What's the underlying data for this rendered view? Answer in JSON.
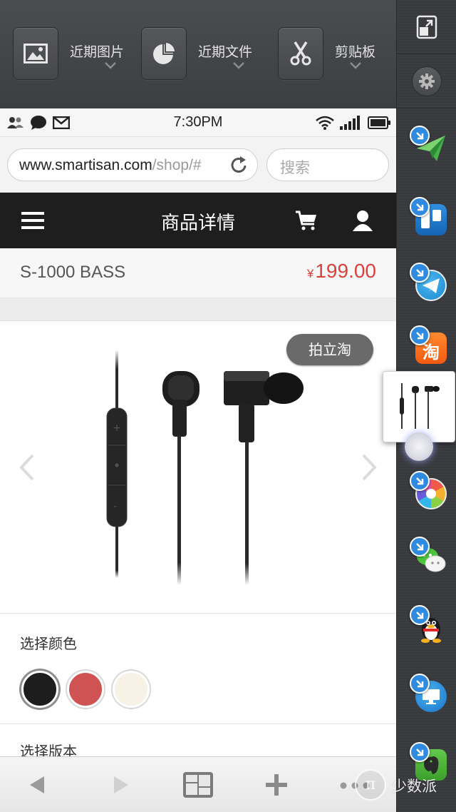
{
  "shelf": {
    "items": [
      {
        "label": "近期图片",
        "icon": "image-icon"
      },
      {
        "label": "近期文件",
        "icon": "pie-chart-icon"
      },
      {
        "label": "剪贴板",
        "icon": "scissors-icon"
      }
    ]
  },
  "status_bar": {
    "time": "7:30PM"
  },
  "browser": {
    "url_host": "www.smartisan.com",
    "url_path": "/shop/#",
    "search_placeholder": "搜索"
  },
  "nav": {
    "title": "商品详情"
  },
  "product": {
    "name": "S-1000 BASS",
    "currency": "¥",
    "price": "199.00",
    "buy_button": "拍立淘"
  },
  "color_section": {
    "title": "选择颜色",
    "swatches": [
      {
        "color": "#1d1d1d",
        "selected": true
      },
      {
        "color": "#cf5353",
        "selected": false
      },
      {
        "color": "#f8f1e6",
        "selected": false
      }
    ]
  },
  "version_section": {
    "title": "选择版本"
  },
  "sidebar": {
    "apps": [
      "paper-plane-app-icon",
      "trello-app-icon",
      "telegram-app-icon",
      "taobao-app-icon",
      "camera-app-icon",
      "wechat-app-icon",
      "qq-app-icon",
      "remote-desktop-app-icon",
      "evernote-app-icon"
    ],
    "taobao_icon_text": "淘"
  },
  "watermark": {
    "symbol": "π",
    "text": "少数派"
  }
}
